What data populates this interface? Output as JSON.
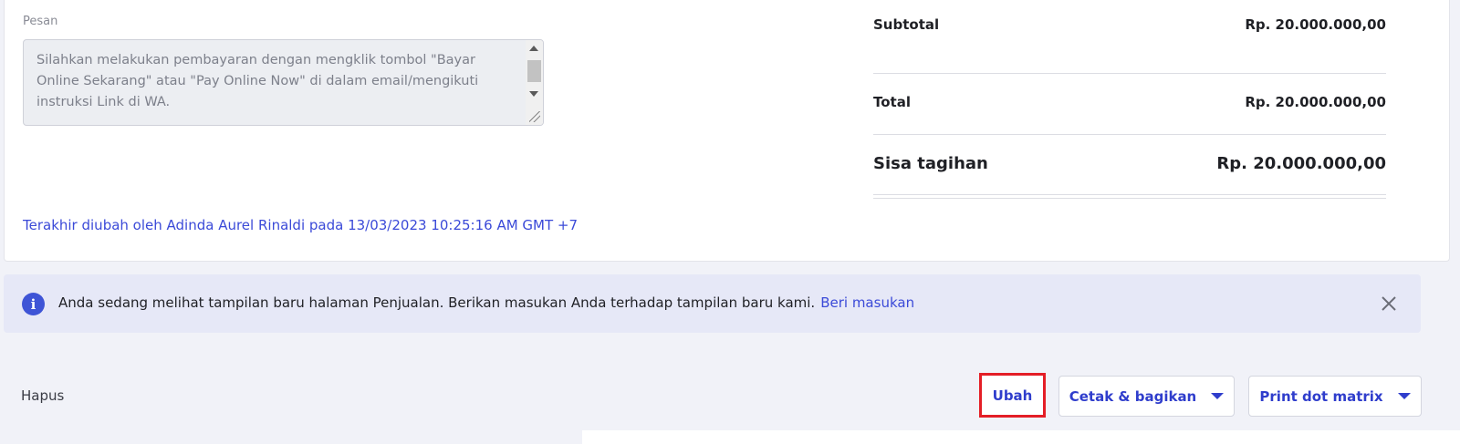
{
  "message": {
    "label": "Pesan",
    "text": "Silahkan melakukan pembayaran dengan mengklik tombol \"Bayar Online Sekarang\" atau \"Pay Online Now\" di dalam email/mengikuti instruksi Link di WA."
  },
  "last_modified": "Terakhir diubah oleh Adinda Aurel Rinaldi pada 13/03/2023 10:25:16 AM GMT +7",
  "summary": {
    "subtotal_label": "Subtotal",
    "subtotal_value": "Rp. 20.000.000,00",
    "total_label": "Total",
    "total_value": "Rp. 20.000.000,00",
    "balance_label": "Sisa tagihan",
    "balance_value": "Rp. 20.000.000,00"
  },
  "banner": {
    "icon": "info-icon",
    "text": "Anda sedang melihat tampilan baru halaman Penjualan. Berikan masukan Anda terhadap tampilan baru kami.",
    "link": "Beri masukan",
    "close_icon": "close-icon"
  },
  "actions": {
    "delete_label": "Hapus",
    "edit_label": "Ubah",
    "print_share_label": "Cetak & bagikan",
    "print_dot_matrix_label": "Print dot matrix"
  },
  "colors": {
    "accent": "#3b4ad8",
    "highlight": "#e41e26",
    "banner_bg": "#e6e8f7"
  }
}
